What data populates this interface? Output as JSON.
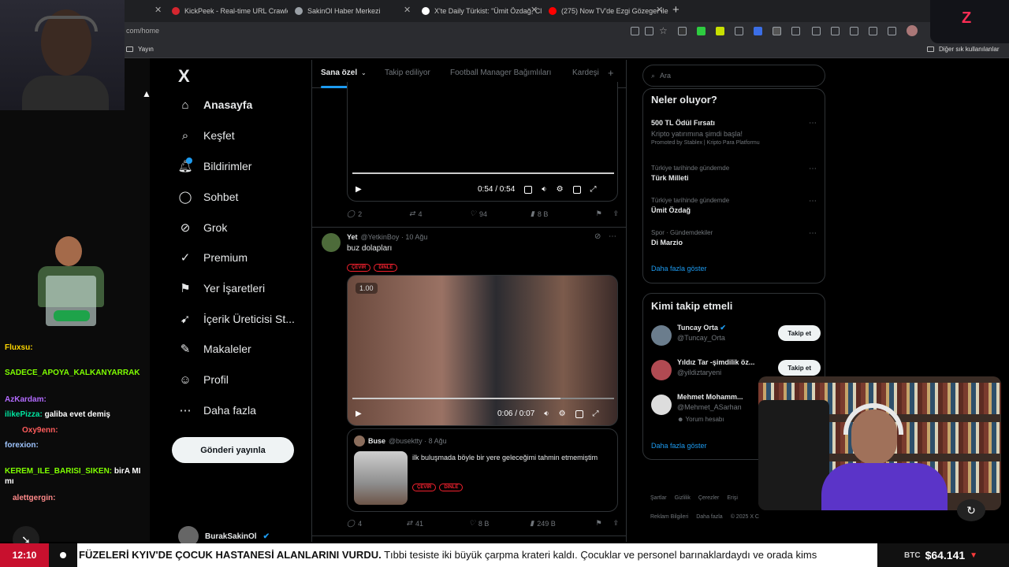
{
  "browser": {
    "tabs": [
      {
        "label": "KickPeek - Real-time URL Crawler",
        "color": "#d5262f"
      },
      {
        "label": "SakinOl Haber Merkezi",
        "color": "#9aa0a6"
      },
      {
        "label": "X'te Daily Türkist: \"Ümit Özdağ, Cl",
        "color": "#ffffff"
      },
      {
        "label": "(275) Now TV'de Ezgi Gözeger ile",
        "color": "#ff0000"
      }
    ],
    "url": "com/home",
    "bookmark_left": "Yayın",
    "bookmark_right": "Diğer sık kullanılanlar"
  },
  "chat": [
    {
      "user": "Fluxsu:",
      "text": "",
      "color": "#ffd700"
    },
    {
      "user": "SADECE_APOYA_KALKANYARRAK",
      "text": "",
      "color": "#7fff00"
    },
    {
      "user": "AzKardam:",
      "text": "",
      "color": "#b36bff"
    },
    {
      "user": "ilikePizza:",
      "text": "galiba evet demiş",
      "color": "#00e5a0"
    },
    {
      "user": "Oxy9enn:",
      "text": "",
      "color": "#ff5c5c"
    },
    {
      "user": "forexion:",
      "text": "",
      "color": "#9fc5ff"
    },
    {
      "user": "KEREM_ILE_BARISI_SIKEN:",
      "text": "birA MI mı",
      "color": "#7fff00"
    },
    {
      "user": "alettgergin:",
      "text": "",
      "color": "#ff8a8a"
    }
  ],
  "sidebar": {
    "logo": "X",
    "items": [
      {
        "label": "Anasayfa",
        "icon": "home-icon"
      },
      {
        "label": "Keşfet",
        "icon": "search-icon"
      },
      {
        "label": "Bildirimler",
        "icon": "bell-icon"
      },
      {
        "label": "Sohbet",
        "icon": "chat-icon"
      },
      {
        "label": "Grok",
        "icon": "grok-icon"
      },
      {
        "label": "Premium",
        "icon": "premium-icon"
      },
      {
        "label": "Yer İşaretleri",
        "icon": "bookmark-icon"
      },
      {
        "label": "İçerik Üreticisi St...",
        "icon": "rocket-icon"
      },
      {
        "label": "Makaleler",
        "icon": "article-icon"
      },
      {
        "label": "Profil",
        "icon": "person-icon"
      },
      {
        "label": "Daha fazla",
        "icon": "more-icon"
      }
    ],
    "post_button": "Gönderi yayınla",
    "profile_name": "BurakSakinOl"
  },
  "main": {
    "tabs": [
      "Sana özel",
      "Takip ediliyor",
      "Football Manager Bağımlıları",
      "Kardeşi"
    ],
    "post1": {
      "time": "0:54 / 0:54",
      "replies": "2",
      "reposts": "4",
      "likes": "94",
      "views": "8 B"
    },
    "post2": {
      "author": "Yet",
      "handle": "@YetkinBoy · 10 Ağu",
      "text": "buz dolapları",
      "tags": [
        "ÇEVİR",
        "DİNLE"
      ],
      "speed": "1.00",
      "time": "0:06 / 0:07",
      "quote": {
        "author": "Buse",
        "handle": "@busektty · 8 Ağu",
        "text": "ilk buluşmada böyle bir yere geleceğimi tahmin etmemiştim",
        "tags": [
          "ÇEVİR",
          "DİNLE"
        ]
      },
      "replies": "4",
      "reposts": "41",
      "likes": "8 B",
      "views": "249 B"
    }
  },
  "right": {
    "search_placeholder": "Ara",
    "trends_title": "Neler oluyor?",
    "trends": [
      {
        "meta": "",
        "name": "500 TL Ödül Fırsatı",
        "sub": "Kripto yatırımına şimdi başla!",
        "promo": "Promoted by Stablex | Kripto Para Platformu"
      },
      {
        "meta": "Türkiye tarihinde gündemde",
        "name": "Türk Milleti"
      },
      {
        "meta": "Türkiye tarihinde gündemde",
        "name": "Ümit Özdağ"
      },
      {
        "meta": "Spor · Gündemdekiler",
        "name": "Di Marzio"
      }
    ],
    "show_more": "Daha fazla göster",
    "who_title": "Kimi takip etmeli",
    "who": [
      {
        "name": "Tuncay Orta",
        "handle": "@Tuncay_Orta",
        "button": "Takip et"
      },
      {
        "name": "Yıldız Tar -şimdilik öz...",
        "handle": "@yildiztaryeni",
        "button": "Takip et"
      },
      {
        "name": "Mehmet Mohamm...",
        "handle": "@Mehmet_ASarhan",
        "note": "Yorum hesabı"
      }
    ],
    "who_more": "Daha fazla göster",
    "footer": [
      "Şartlar",
      "Gizlilik",
      "Çerezler",
      "Erişi",
      "Reklam Bilgileri",
      "Daha fazla",
      "© 2025 X C"
    ]
  },
  "ticker": {
    "clock": "12:10",
    "news": "FÜZELERİ KYIV'DE ÇOCUK HASTANESİ ALANLARINI VURDU.",
    "news2": " Tıbbi tesiste iki büyük çarpma krateri kaldı. Çocuklar ve personel barınaklardaydı ve orada kims",
    "btc_label": "BTC",
    "btc_value": "$64.141"
  }
}
